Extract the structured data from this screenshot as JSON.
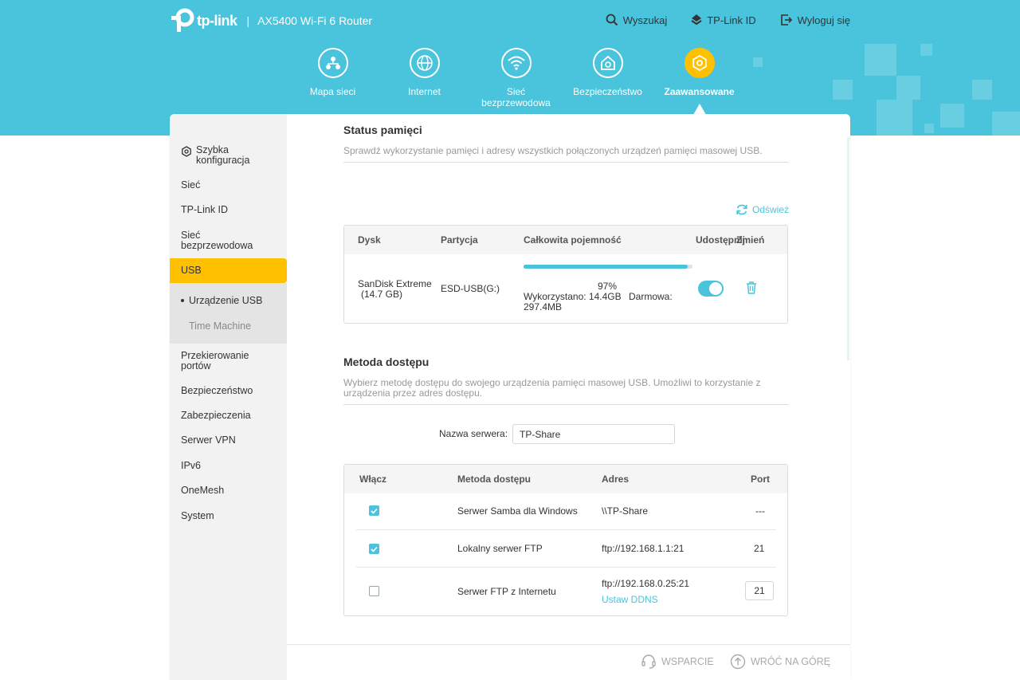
{
  "header": {
    "logo_text": "tp-link",
    "separator": "|",
    "model": "AX5400 Wi-Fi 6 Router",
    "actions": [
      {
        "icon": "search-icon",
        "label": "Wyszukaj"
      },
      {
        "icon": "tplink-id-icon",
        "label": "TP-Link ID"
      },
      {
        "icon": "logout-icon",
        "label": "Wyloguj się"
      }
    ]
  },
  "nav": {
    "items": [
      {
        "icon": "network-map-icon",
        "label": "Mapa sieci"
      },
      {
        "icon": "globe-icon",
        "label": "Internet"
      },
      {
        "icon": "wifi-icon",
        "label": "Sieć bezprzewodowa"
      },
      {
        "icon": "security-home-icon",
        "label": "Bezpieczeństwo"
      },
      {
        "icon": "advanced-gear-icon",
        "label": "Zaawansowane",
        "active": true
      }
    ]
  },
  "sidebar": {
    "items": [
      {
        "label": "Szybka konfiguracja",
        "icon": "quick-setup-gear-icon"
      },
      {
        "label": "Sieć"
      },
      {
        "label": "TP-Link ID"
      },
      {
        "label": "Sieć bezprzewodowa"
      },
      {
        "label": "USB",
        "active": true
      },
      {
        "label": "Przekierowanie portów"
      },
      {
        "label": "Bezpieczeństwo"
      },
      {
        "label": "Zabezpieczenia"
      },
      {
        "label": "Serwer VPN"
      },
      {
        "label": "IPv6"
      },
      {
        "label": "OneMesh"
      },
      {
        "label": "System"
      }
    ],
    "sub_items": [
      {
        "label": "Urządzenie USB",
        "active": true
      },
      {
        "label": "Time Machine"
      }
    ]
  },
  "storage": {
    "title": "Status pamięci",
    "description": "Sprawdź wykorzystanie pamięci i adresy wszystkich połączonych urządzeń pamięci masowej USB.",
    "refresh_label": "Odśwież",
    "headers": {
      "disk": "Dysk",
      "partition": "Partycja",
      "capacity": "Całkowita pojemność",
      "share": "Udostępnij",
      "modify": "Zmień"
    },
    "row": {
      "disk_line1": "SanDisk   Extreme",
      "disk_line2": "(14.7 GB)",
      "partition": "ESD-USB(G:)",
      "usage_percent_text": "97%",
      "usage_fraction": 0.97,
      "used": "Wykorzystano: 14.4GB",
      "free_label": "Darmowa:",
      "free_value": "297.4MB",
      "shared": true
    }
  },
  "access": {
    "title": "Metoda dostępu",
    "description": "Wybierz metodę dostępu do swojego urządzenia pamięci masowej USB. Umożliwi to korzystanie z urządzenia przez adres dostępu.",
    "server_label": "Nazwa serwera:",
    "server_value": "TP-Share",
    "headers": {
      "enable": "Włącz",
      "method": "Metoda dostępu",
      "address": "Adres",
      "port": "Port"
    },
    "rows": [
      {
        "checked": true,
        "method": "Serwer Samba dla Windows",
        "address": "\\\\TP-Share",
        "port": "---"
      },
      {
        "checked": true,
        "method": "Lokalny serwer FTP",
        "address": "ftp://192.168.1.1:21",
        "port": "21"
      },
      {
        "checked": false,
        "method": "Serwer FTP z Internetu",
        "address": "ftp://192.168.0.25:21",
        "link": "Ustaw DDNS",
        "port": "21"
      }
    ]
  },
  "footer": {
    "support": "WSPARCIE",
    "back_to_top": "WRÓĆ NA GÓRĘ"
  },
  "colors": {
    "brand": "#4ac4dc",
    "accent": "#ffc000"
  }
}
